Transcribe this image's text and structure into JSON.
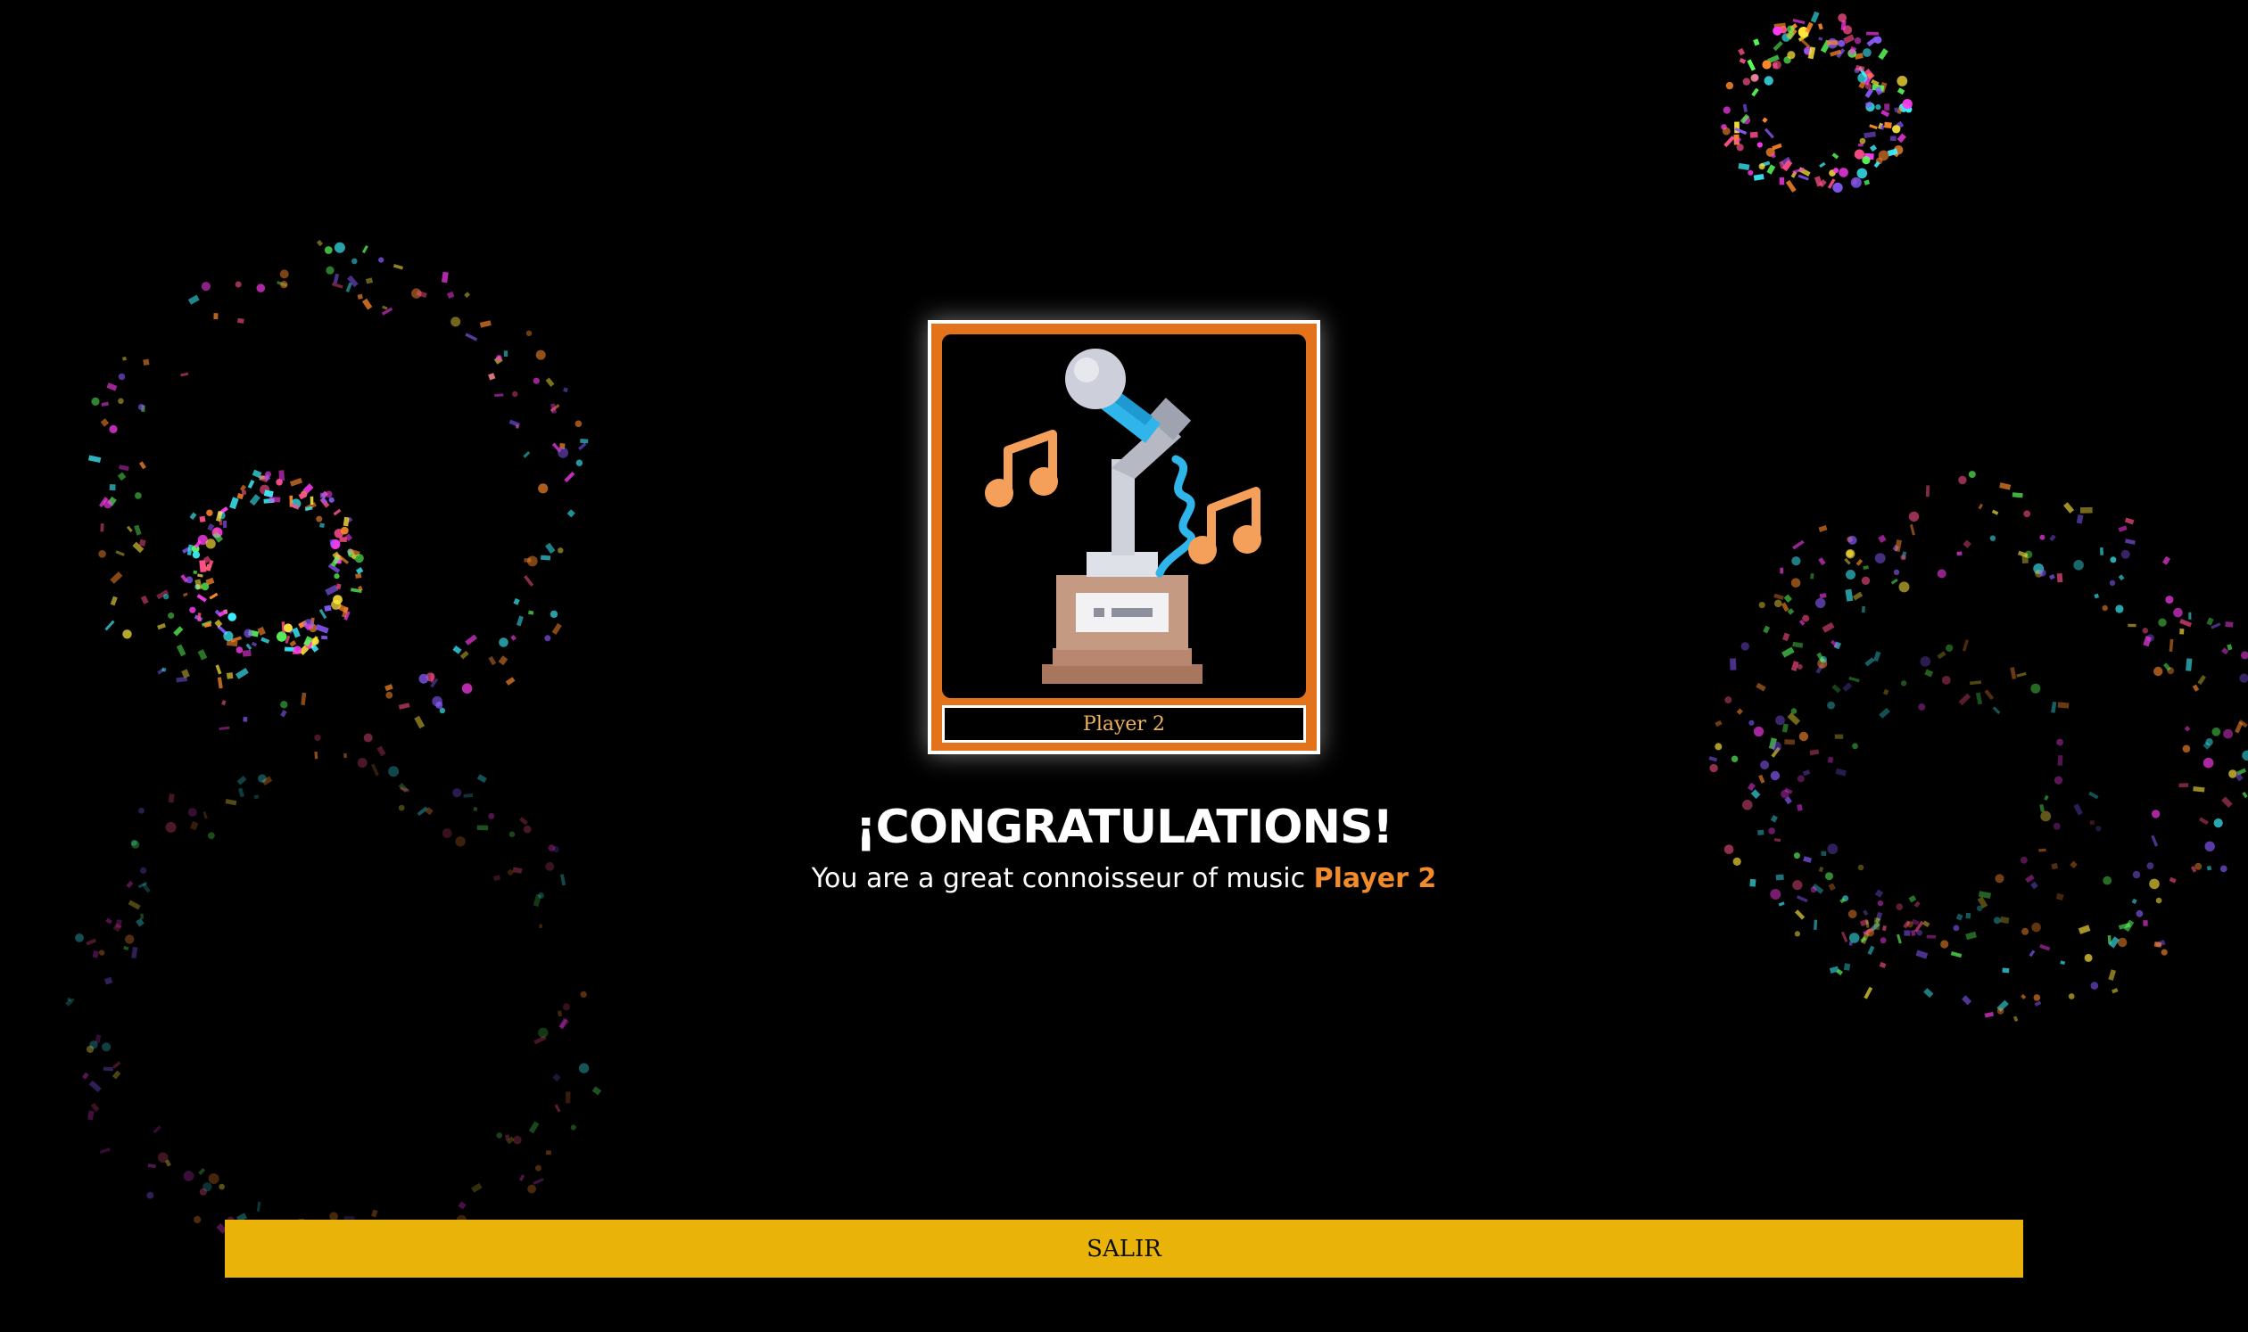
{
  "trophy": {
    "icon": "microphone-trophy-icon",
    "player_label": "Player 2"
  },
  "congrats": {
    "title": "¡CONGRATULATIONS!",
    "message": "You are a great connoisseur of music",
    "player": "Player 2"
  },
  "exit_button": {
    "label": "SALIR"
  },
  "colors": {
    "background": "#000000",
    "card_frame": "#e2721c",
    "accent_text": "#f28c2b",
    "plate_text": "#f0b25a",
    "button": "#e9b30a",
    "confetti": [
      "#ff3cf2",
      "#ffe53b",
      "#3cf2ff",
      "#5bff5b",
      "#ff8a2b",
      "#8a5bff",
      "#ff4f8b"
    ]
  }
}
